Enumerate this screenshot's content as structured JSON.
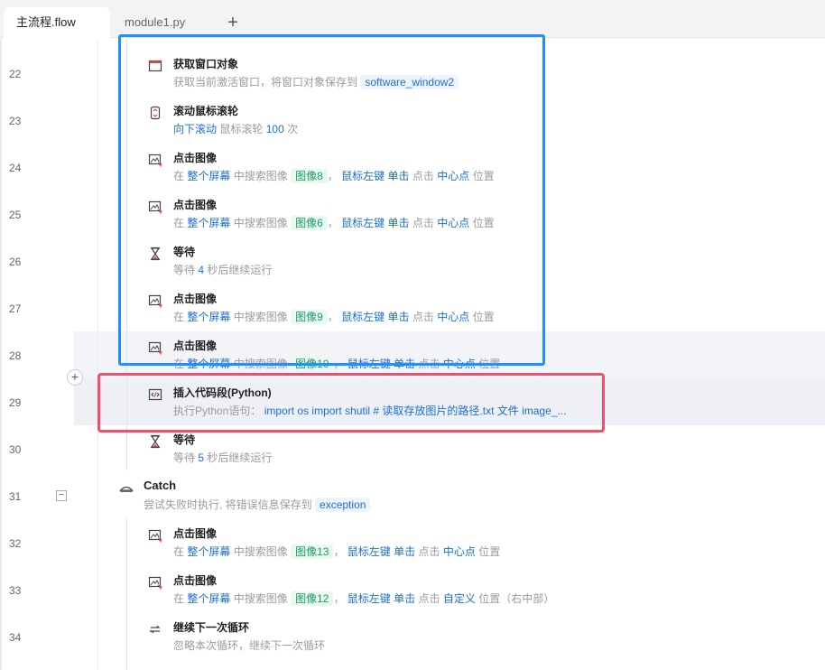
{
  "tabs": [
    {
      "label": "主流程.flow",
      "active": true
    },
    {
      "label": "module1.py",
      "active": false
    }
  ],
  "tab_add_symbol": "+",
  "add_step_symbol": "+",
  "collapse_symbol": "−",
  "line_numbers": [
    "22",
    "23",
    "24",
    "25",
    "26",
    "27",
    "28",
    "29",
    "30",
    "31",
    "32",
    "33",
    "34"
  ],
  "steps": [
    {
      "icon": "window-icon",
      "title": "获取窗口对象",
      "desc": {
        "t1": "获取当前激活窗口，将窗口对象保存到",
        "v1": "software_window2"
      }
    },
    {
      "icon": "mouse-wheel-icon",
      "title": "滚动鼠标滚轮",
      "desc": {
        "k1": "向下滚动",
        "t1": "鼠标滚轮",
        "k2": "100",
        "t2": "次"
      }
    },
    {
      "icon": "image-click-icon",
      "title": "点击图像",
      "desc": {
        "t1": "在",
        "k1": "整个屏幕",
        "t2": "中搜索图像",
        "img": "图像8",
        "t3": "，",
        "k2": "鼠标左键",
        "k3": "单击",
        "t4": "点击",
        "k4": "中心点",
        "t5": "位置"
      }
    },
    {
      "icon": "image-click-icon",
      "title": "点击图像",
      "desc": {
        "t1": "在",
        "k1": "整个屏幕",
        "t2": "中搜索图像",
        "img": "图像6",
        "t3": "，",
        "k2": "鼠标左键",
        "k3": "单击",
        "t4": "点击",
        "k4": "中心点",
        "t5": "位置"
      }
    },
    {
      "icon": "hourglass-icon",
      "title": "等待",
      "desc": {
        "t1": "等待",
        "k1": "4",
        "t2": "秒后继续运行"
      }
    },
    {
      "icon": "image-click-icon",
      "title": "点击图像",
      "desc": {
        "t1": "在",
        "k1": "整个屏幕",
        "t2": "中搜索图像",
        "img": "图像9",
        "t3": "，",
        "k2": "鼠标左键",
        "k3": "单击",
        "t4": "点击",
        "k4": "中心点",
        "t5": "位置"
      }
    },
    {
      "icon": "image-click-icon",
      "title": "点击图像",
      "desc": {
        "t1": "在",
        "k1": "整个屏幕",
        "t2": "中搜索图像",
        "img": "图像10",
        "t3": "，",
        "k2": "鼠标左键",
        "k3": "单击",
        "t4": "点击",
        "k4": "中心点",
        "t5": "位置"
      }
    },
    {
      "icon": "code-snippet-icon",
      "title": "插入代码段(Python)",
      "desc": {
        "t1": "执行Python语句：",
        "code": "import os import shutil  # 读取存放图片的路径.txt 文件 image_..."
      }
    },
    {
      "icon": "hourglass-icon",
      "title": "等待",
      "desc": {
        "t1": "等待",
        "k1": "5",
        "t2": "秒后继续运行"
      }
    },
    {
      "icon": "catch-icon",
      "title": "Catch",
      "desc": {
        "t1": "尝试失败时执行, 将错误信息保存到",
        "v1": "exception"
      }
    },
    {
      "icon": "image-click-icon",
      "title": "点击图像",
      "desc": {
        "t1": "在",
        "k1": "整个屏幕",
        "t2": "中搜索图像",
        "img": "图像13",
        "t3": "，",
        "k2": "鼠标左键",
        "k3": "单击",
        "t4": "点击",
        "k4": "中心点",
        "t5": "位置"
      }
    },
    {
      "icon": "image-click-icon",
      "title": "点击图像",
      "desc": {
        "t1": "在",
        "k1": "整个屏幕",
        "t2": "中搜索图像",
        "img": "图像12",
        "t3": "，",
        "k2": "鼠标左键",
        "k3": "单击",
        "t4": "点击",
        "k4": "自定义",
        "t5": "位置（右中部）"
      }
    },
    {
      "icon": "loop-continue-icon",
      "title": "继续下一次循环",
      "desc": {
        "t1": "忽略本次循环，继续下一次循环"
      }
    }
  ],
  "colors": {
    "keyword": "#1a6fd6",
    "image_tag": "#19a063",
    "blue_outline": "#1e90ff",
    "red_outline": "#f0506e"
  }
}
